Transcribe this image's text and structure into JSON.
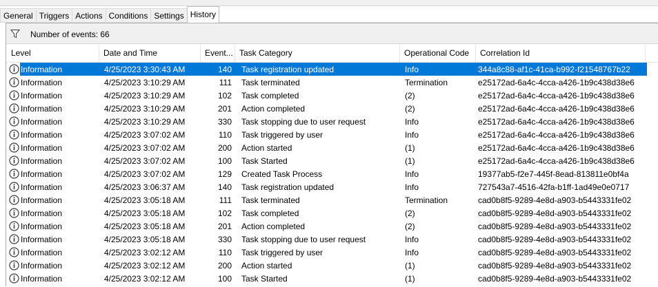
{
  "tabs": [
    {
      "label": "General",
      "active": false
    },
    {
      "label": "Triggers",
      "active": false
    },
    {
      "label": "Actions",
      "active": false
    },
    {
      "label": "Conditions",
      "active": false
    },
    {
      "label": "Settings",
      "active": false
    },
    {
      "label": "History",
      "active": true
    }
  ],
  "filter": {
    "count_text": "Number of events: 66",
    "icon": "filter-icon"
  },
  "columns": [
    "Level",
    "Date and Time",
    "Event...",
    "Task Category",
    "Operational Code",
    "Correlation Id"
  ],
  "selected_row": 0,
  "colors": {
    "selection": "#0078d7",
    "tab_bg": "#f0f0f0"
  },
  "rows": [
    {
      "level": "Information",
      "date": "4/25/2023 3:30:43 AM",
      "event": "140",
      "category": "Task registration updated",
      "op": "Info",
      "corr": "344a8c88-af1c-41ca-b992-f21548767b22"
    },
    {
      "level": "Information",
      "date": "4/25/2023 3:10:29 AM",
      "event": "111",
      "category": "Task terminated",
      "op": "Termination",
      "corr": "e25172ad-6a4c-4cca-a426-1b9c438d38e6"
    },
    {
      "level": "Information",
      "date": "4/25/2023 3:10:29 AM",
      "event": "102",
      "category": "Task completed",
      "op": "(2)",
      "corr": "e25172ad-6a4c-4cca-a426-1b9c438d38e6"
    },
    {
      "level": "Information",
      "date": "4/25/2023 3:10:29 AM",
      "event": "201",
      "category": "Action completed",
      "op": "(2)",
      "corr": "e25172ad-6a4c-4cca-a426-1b9c438d38e6"
    },
    {
      "level": "Information",
      "date": "4/25/2023 3:10:29 AM",
      "event": "330",
      "category": "Task stopping due to user request",
      "op": "Info",
      "corr": "e25172ad-6a4c-4cca-a426-1b9c438d38e6"
    },
    {
      "level": "Information",
      "date": "4/25/2023 3:07:02 AM",
      "event": "110",
      "category": "Task triggered by user",
      "op": "Info",
      "corr": "e25172ad-6a4c-4cca-a426-1b9c438d38e6"
    },
    {
      "level": "Information",
      "date": "4/25/2023 3:07:02 AM",
      "event": "200",
      "category": "Action started",
      "op": "(1)",
      "corr": "e25172ad-6a4c-4cca-a426-1b9c438d38e6"
    },
    {
      "level": "Information",
      "date": "4/25/2023 3:07:02 AM",
      "event": "100",
      "category": "Task Started",
      "op": "(1)",
      "corr": "e25172ad-6a4c-4cca-a426-1b9c438d38e6"
    },
    {
      "level": "Information",
      "date": "4/25/2023 3:07:02 AM",
      "event": "129",
      "category": "Created Task Process",
      "op": "Info",
      "corr": "19377ab5-f2e7-445f-8ead-813811e0bf4a"
    },
    {
      "level": "Information",
      "date": "4/25/2023 3:06:37 AM",
      "event": "140",
      "category": "Task registration updated",
      "op": "Info",
      "corr": "727543a7-4516-42fa-b1ff-1ad49e0e0717"
    },
    {
      "level": "Information",
      "date": "4/25/2023 3:05:18 AM",
      "event": "111",
      "category": "Task terminated",
      "op": "Termination",
      "corr": "cad0b8f5-9289-4e8d-a903-b5443331fe02"
    },
    {
      "level": "Information",
      "date": "4/25/2023 3:05:18 AM",
      "event": "102",
      "category": "Task completed",
      "op": "(2)",
      "corr": "cad0b8f5-9289-4e8d-a903-b5443331fe02"
    },
    {
      "level": "Information",
      "date": "4/25/2023 3:05:18 AM",
      "event": "201",
      "category": "Action completed",
      "op": "(2)",
      "corr": "cad0b8f5-9289-4e8d-a903-b5443331fe02"
    },
    {
      "level": "Information",
      "date": "4/25/2023 3:05:18 AM",
      "event": "330",
      "category": "Task stopping due to user request",
      "op": "Info",
      "corr": "cad0b8f5-9289-4e8d-a903-b5443331fe02"
    },
    {
      "level": "Information",
      "date": "4/25/2023 3:02:12 AM",
      "event": "110",
      "category": "Task triggered by user",
      "op": "Info",
      "corr": "cad0b8f5-9289-4e8d-a903-b5443331fe02"
    },
    {
      "level": "Information",
      "date": "4/25/2023 3:02:12 AM",
      "event": "200",
      "category": "Action started",
      "op": "(1)",
      "corr": "cad0b8f5-9289-4e8d-a903-b5443331fe02"
    },
    {
      "level": "Information",
      "date": "4/25/2023 3:02:12 AM",
      "event": "100",
      "category": "Task Started",
      "op": "(1)",
      "corr": "cad0b8f5-9289-4e8d-a903-b5443331fe02"
    }
  ]
}
